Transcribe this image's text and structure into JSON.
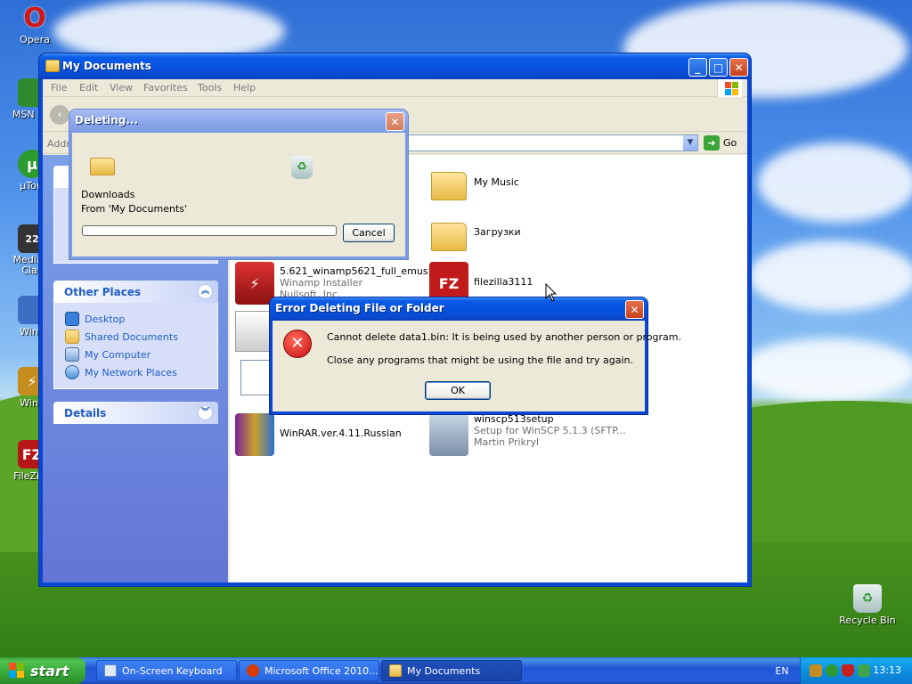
{
  "desktop": {
    "icons": [
      {
        "label": "Opera",
        "icon": "opera-icon",
        "color": "#d01818"
      },
      {
        "label": "MSN Ins",
        "icon": "msn-icon",
        "color": "#2f8a2f"
      },
      {
        "label": "µTorr",
        "icon": "utorrent-icon",
        "color": "#2d9a2d"
      },
      {
        "label": "Media F\nClas",
        "icon": "media-player-icon",
        "color": "#333333"
      },
      {
        "label": "WinS",
        "icon": "winscp-icon",
        "color": "#3a6fc4"
      },
      {
        "label": "Wina",
        "icon": "winamp-icon",
        "color": "#c58d1d"
      },
      {
        "label": "FileZilla",
        "icon": "filezilla-icon",
        "color": "#b51616"
      }
    ],
    "recycle_bin": {
      "label": "Recycle Bin",
      "icon": "recycle-bin-icon"
    }
  },
  "explorer": {
    "title": "My Documents",
    "menu": [
      "File",
      "Edit",
      "View",
      "Favorites",
      "Tools",
      "Help"
    ],
    "address_label": "Addre",
    "go_label": "Go",
    "other_places": {
      "title": "Other Places",
      "links": [
        {
          "label": "Desktop",
          "icon": "desktop-icon"
        },
        {
          "label": "Shared Documents",
          "icon": "folder-icon"
        },
        {
          "label": "My Computer",
          "icon": "my-computer-icon"
        },
        {
          "label": "My Network Places",
          "icon": "network-places-icon"
        }
      ]
    },
    "details": {
      "title": "Details"
    },
    "files": [
      {
        "name": "My Music",
        "icon": "my-music-folder-icon"
      },
      {
        "name": "Загрузки",
        "icon": "folder-icon"
      },
      {
        "name": "5.621_winamp5621_full_emus...",
        "sub1": "Winamp Installer",
        "sub2": "Nullsoft, Inc.",
        "icon": "winamp-installer-icon"
      },
      {
        "name": "filezilla3111",
        "icon": "filezilla-icon"
      },
      {
        "name": "WinRAR.ver.4.11.Russian",
        "icon": "winrar-icon"
      },
      {
        "name": "winscp513setup",
        "sub1": "Setup for WinSCP 5.1.3 (SFTP...",
        "sub2": "Martin Prikryl",
        "icon": "winscp-setup-icon"
      }
    ]
  },
  "deleting_dialog": {
    "title": "Deleting...",
    "item_name": "Downloads",
    "item_from": "From 'My Documents'",
    "progress_fraction": 0.0,
    "cancel_label": "Cancel"
  },
  "error_dialog": {
    "title": "Error Deleting File or Folder",
    "message": "Cannot delete data1.bin: It is being used by another person or program.",
    "hint": "Close any programs that might be using the file and try again.",
    "ok_label": "OK"
  },
  "taskbar": {
    "start_label": "start",
    "tasks": [
      {
        "label": "On-Screen Keyboard",
        "icon": "keyboard-icon",
        "active": false
      },
      {
        "label": "Microsoft Office 2010...",
        "icon": "office-icon",
        "active": false
      },
      {
        "label": "My Documents",
        "icon": "folder-icon",
        "active": true
      }
    ],
    "language": "EN",
    "clock": "13:13"
  }
}
